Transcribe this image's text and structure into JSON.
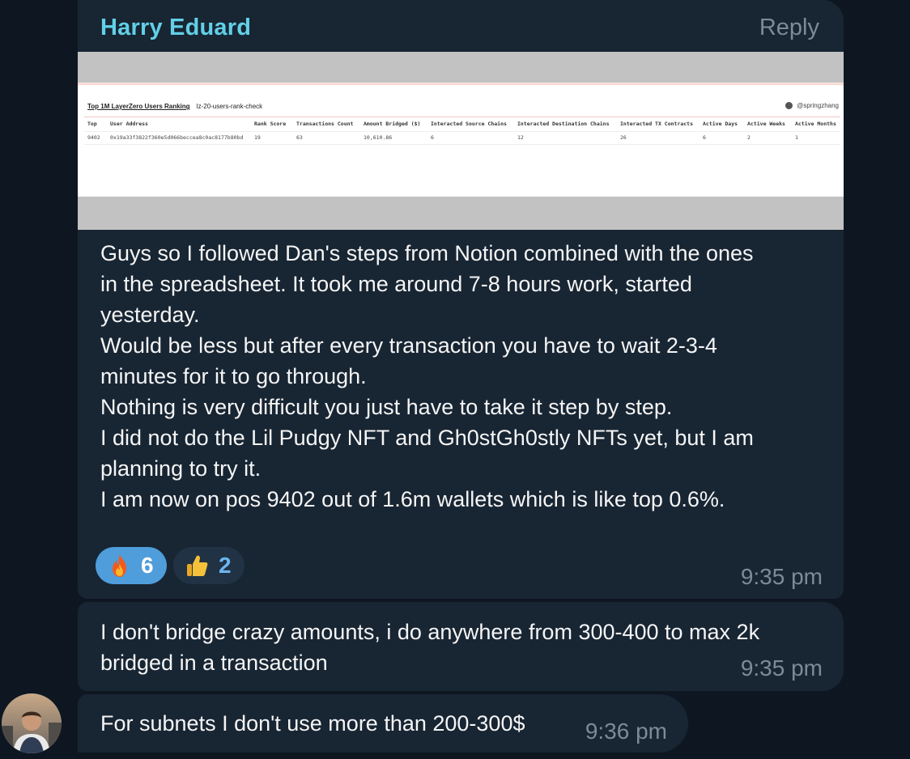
{
  "message1": {
    "sender": "Harry Eduard",
    "reply_label": "Reply",
    "screenshot": {
      "title": "Top 1M LayerZero Users Ranking",
      "subtitle": "lz-20-users-rank-check",
      "user": "@springzhang",
      "headers": [
        "Top",
        "User Address",
        "Rank Score",
        "Transactions Count",
        "Amount Bridged ($)",
        "Interacted Source Chains",
        "Interacted Destination Chains",
        "Interacted TX Contracts",
        "Active Days",
        "Active Weeks",
        "Active Months"
      ],
      "row": [
        "9402",
        "0x19a33f3822f360e5d066beccea8c0ac8177b80bd",
        "19",
        "63",
        "10,610.86",
        "6",
        "12",
        "26",
        "6",
        "2",
        "1"
      ]
    },
    "lines": [
      "Guys so I followed Dan's steps from Notion combined with the ones",
      "in the spreadsheet. It took me around 7-8 hours work, started",
      "yesterday.",
      "Would be less but after every transaction you have to wait 2-3-4",
      "minutes for it to go through.",
      "Nothing is very difficult you just have to take it step by step.",
      "I did not do the Lil Pudgy NFT and Gh0stGh0stly NFTs yet, but I am",
      "planning to try it.",
      "I am now on pos 9402 out of 1.6m wallets which is like top 0.6%."
    ],
    "reactions": [
      {
        "emoji": "fire-icon",
        "count": "6",
        "color": "#4f9ddb"
      },
      {
        "emoji": "thumbs-up-icon",
        "count": "2",
        "color": "#213244"
      }
    ],
    "time": "9:35 pm"
  },
  "message2": {
    "lines": [
      "I don't bridge crazy amounts, i do anywhere from 300-400 to max 2k",
      "bridged in a transaction"
    ],
    "time": "9:35 pm"
  },
  "message3": {
    "text": "For subnets I don't use more than 200-300$",
    "time": "9:36 pm"
  },
  "colors": {
    "background": "#0e1621",
    "bubble": "#182533",
    "sender": "#62d0e6",
    "muted": "#7d8b99"
  }
}
